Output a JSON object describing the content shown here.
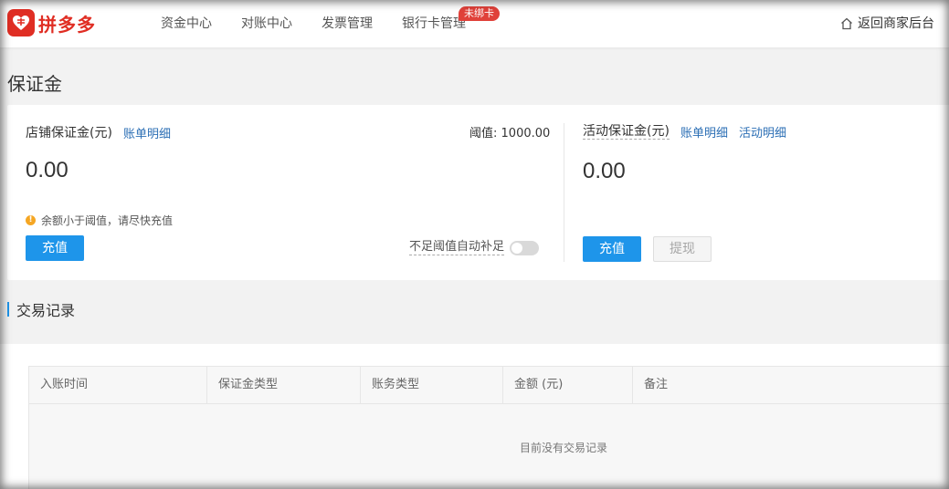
{
  "header": {
    "logo_text": "拼多多",
    "nav": [
      {
        "label": "资金中心"
      },
      {
        "label": "对账中心"
      },
      {
        "label": "发票管理"
      },
      {
        "label": "银行卡管理",
        "badge": "未绑卡"
      }
    ],
    "back_label": "返回商家后台"
  },
  "page_title": "保证金",
  "store_deposit": {
    "label": "店铺保证金(元)",
    "details_link": "账单明细",
    "threshold_label": "阈值:",
    "threshold_value": "1000.00",
    "amount": "0.00",
    "warning": "余额小于阈值，请尽快充值",
    "recharge_button": "充值",
    "auto_topup_label": "不足阈值自动补足",
    "auto_topup_enabled": false
  },
  "activity_deposit": {
    "label": "活动保证金(元)",
    "details_link": "账单明细",
    "activity_details_link": "活动明细",
    "amount": "0.00",
    "recharge_button": "充值",
    "withdraw_button": "提现"
  },
  "records": {
    "title": "交易记录",
    "columns": [
      "入账时间",
      "保证金类型",
      "账务类型",
      "金额 (元)",
      "备注"
    ],
    "empty_text": "目前没有交易记录"
  },
  "colors": {
    "brand": "#e02e24",
    "primary": "#1e95ea",
    "link": "#2c6fb5",
    "warning": "#f5a623"
  }
}
